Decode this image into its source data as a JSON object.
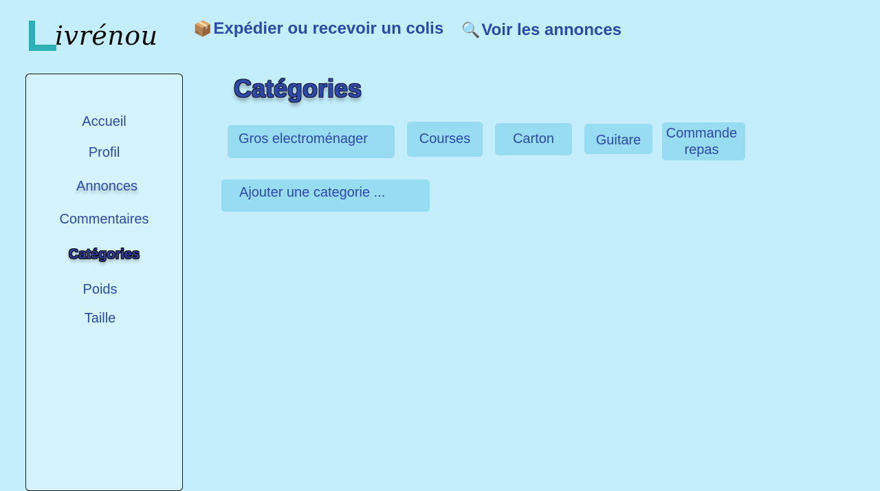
{
  "header": {
    "logo_letter": "L",
    "logo_text": "ivrénou",
    "nav": [
      {
        "icon": "package-icon",
        "emoji": "📦",
        "label": "Expédier ou recevoir un colis"
      },
      {
        "icon": "magnifier-icon",
        "emoji": "🔍",
        "label": "Voir les annonces"
      }
    ]
  },
  "sidebar": {
    "items": [
      {
        "label": "Accueil"
      },
      {
        "label": "Profil"
      },
      {
        "label": "Annonces"
      },
      {
        "label": "Commentaires"
      },
      {
        "label": "Catégories",
        "active": true
      },
      {
        "label": "Poids"
      },
      {
        "label": "Taille"
      }
    ]
  },
  "main": {
    "title": "Catégories",
    "categories": [
      {
        "label": "Gros electroménager"
      },
      {
        "label": "Courses"
      },
      {
        "label": "Carton"
      },
      {
        "label": "Guitare"
      },
      {
        "label": "Commande repas"
      }
    ],
    "add_label": "Ajouter une categorie ..."
  },
  "colors": {
    "background": "#c5eefc",
    "sidebar_bg": "#d4f3fc",
    "chip_bg": "#97dcf1",
    "text_blue": "#2c4aa6",
    "logo_teal": "#2eb0b5"
  }
}
